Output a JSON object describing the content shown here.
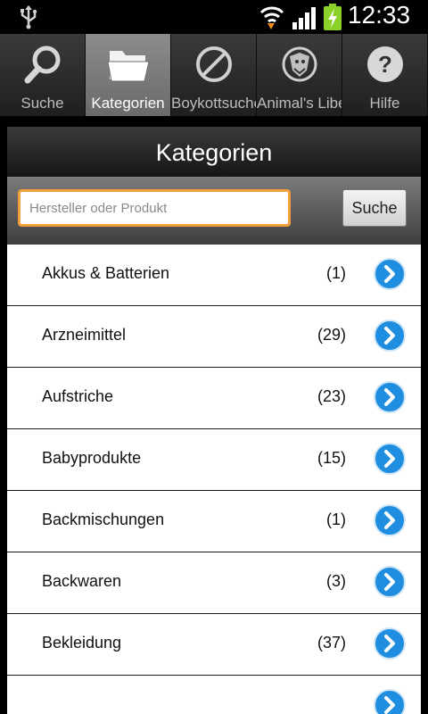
{
  "status_bar": {
    "time": "12:33",
    "icons": [
      "usb-icon",
      "wifi-icon",
      "signal-icon",
      "battery-charging-icon"
    ]
  },
  "tabs": [
    {
      "label": "Suche",
      "icon": "search-icon",
      "active": false
    },
    {
      "label": "Kategorien",
      "icon": "folder-icon",
      "active": true
    },
    {
      "label": "Boykottsuche",
      "icon": "prohibited-icon",
      "active": false
    },
    {
      "label": "Animal's Liberation",
      "icon": "animal-logo-icon",
      "active": false
    },
    {
      "label": "Hilfe",
      "icon": "help-icon",
      "active": false
    }
  ],
  "panel": {
    "title": "Kategorien",
    "search": {
      "placeholder": "Hersteller oder Produkt",
      "value": "",
      "button_label": "Suche"
    }
  },
  "categories": [
    {
      "name": "Akkus & Batterien",
      "count": "(1)"
    },
    {
      "name": "Arzneimittel",
      "count": "(29)"
    },
    {
      "name": "Aufstriche",
      "count": "(23)"
    },
    {
      "name": "Babyprodukte",
      "count": "(15)"
    },
    {
      "name": "Backmischungen",
      "count": "(1)"
    },
    {
      "name": "Backwaren",
      "count": "(3)"
    },
    {
      "name": "Bekleidung",
      "count": "(37)"
    },
    {
      "name": "",
      "count": ""
    }
  ],
  "colors": {
    "accent_orange": "#f2a03a",
    "arrow_blue": "#1f8ee0",
    "header_dark": "#151515"
  }
}
